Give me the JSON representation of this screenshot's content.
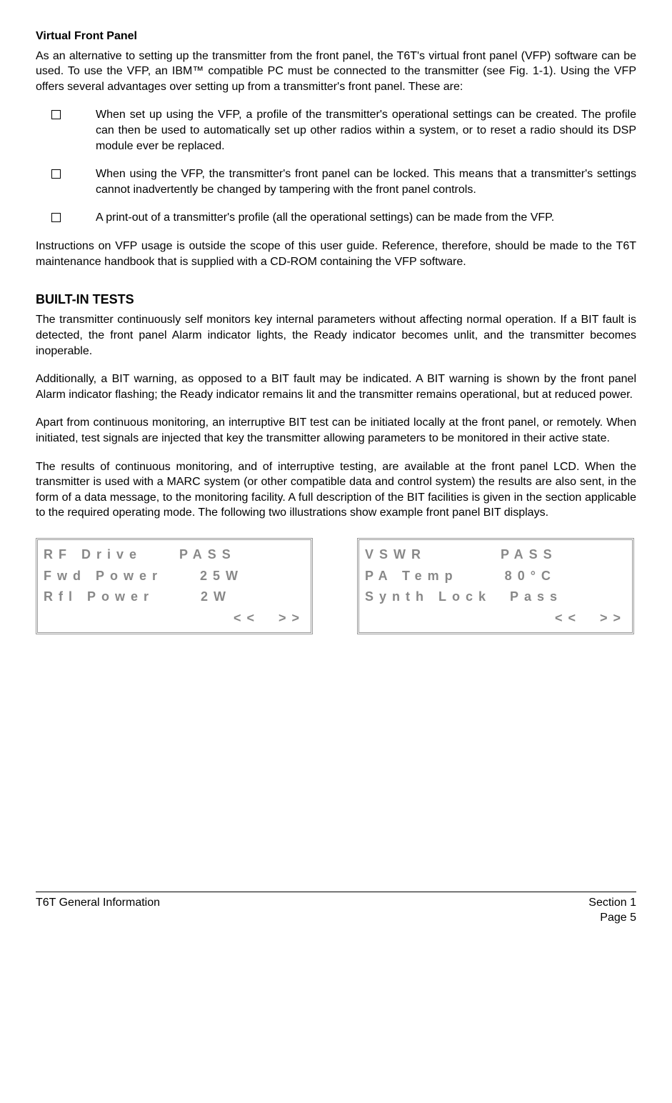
{
  "section1": {
    "title": "Virtual Front Panel",
    "p1": "As an alternative to setting up the transmitter from the front panel, the T6T's virtual front panel (VFP) software can be used. To use the VFP, an IBM™ compatible PC must be connected to the transmitter (see Fig. 1-1). Using the VFP offers several advantages over setting up from a transmitter's front panel. These are:",
    "bullets": [
      "When set up using the VFP, a profile of the transmitter's operational settings can be created. The profile can then be used to automatically set up other radios within a system, or to reset a radio should its DSP module ever be replaced.",
      "When using the VFP, the transmitter's front panel can be locked. This means that a transmitter's settings cannot inadvertently be changed by tampering with the front panel controls.",
      "A print-out of a transmitter's profile (all the operational settings) can be made from the VFP."
    ],
    "p2": "Instructions on VFP usage is outside the scope of this user guide. Reference, therefore, should be made to the T6T maintenance handbook that is supplied with a CD-ROM containing the VFP software."
  },
  "section2": {
    "title": "BUILT-IN TESTS",
    "p1": "The transmitter continuously self monitors key internal parameters without affecting normal operation. If a BIT fault is detected, the front panel Alarm indicator lights, the Ready indicator becomes unlit, and the transmitter becomes inoperable.",
    "p2": "Additionally, a BIT warning, as opposed to a BIT fault may be indicated. A BIT warning is shown by the front panel Alarm indicator flashing; the Ready indicator remains lit and the transmitter remains operational, but at reduced power.",
    "p3": "Apart from continuous monitoring, an interruptive BIT test can be initiated locally at the front panel, or remotely. When initiated, test signals are injected that key the transmitter allowing parameters to be monitored in their active state.",
    "p4": "The results of continuous monitoring, and of interruptive testing, are available at the front panel LCD. When the transmitter is used with a MARC system (or other compatible data and control system) the results are also sent, in the form of a data message, to the monitoring facility. A full description of the BIT facilities is given in the section applicable to the required operating mode. The following two illustrations show example front panel BIT displays."
  },
  "lcd1": {
    "line1": "RF Drive    PASS",
    "line2": "Fwd Power    25W",
    "line3": "Rfl Power     2W",
    "line4": "<<  >>"
  },
  "lcd2": {
    "line1": "VSWR        PASS",
    "line2": "PA Temp     80°C",
    "line3": "Synth Lock  Pass",
    "line4": "<<  >>"
  },
  "footer": {
    "left": "T6T General Information",
    "right1": "Section 1",
    "right2": "Page 5"
  }
}
